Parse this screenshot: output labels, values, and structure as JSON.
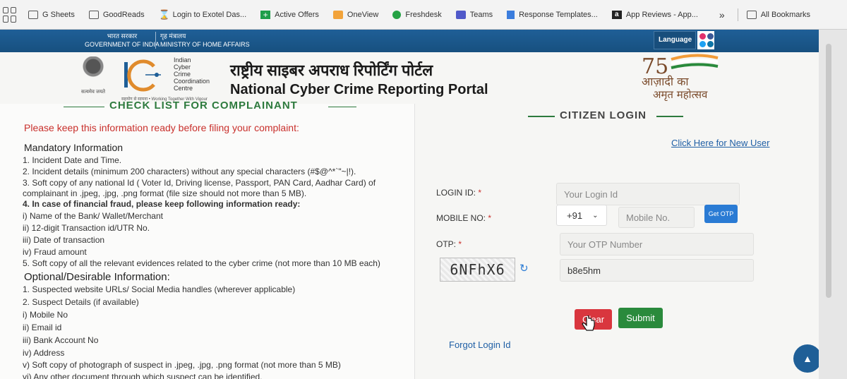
{
  "bookmarks": {
    "items": [
      {
        "label": "G Sheets",
        "icon": "folder-icon"
      },
      {
        "label": "GoodReads",
        "icon": "folder-icon"
      },
      {
        "label": "Login to Exotel Das...",
        "icon": "exotel-icon"
      },
      {
        "label": "Active Offers",
        "icon": "sheets-plus-icon"
      },
      {
        "label": "OneView",
        "icon": "oneview-icon"
      },
      {
        "label": "Freshdesk",
        "icon": "freshdesk-icon"
      },
      {
        "label": "Teams",
        "icon": "teams-icon"
      },
      {
        "label": "Response Templates...",
        "icon": "docs-icon"
      },
      {
        "label": "App Reviews - App...",
        "icon": "app-reviews-icon"
      }
    ],
    "more": "»",
    "all_bookmarks": "All Bookmarks"
  },
  "gov_bar": {
    "hindi_govt": "भारत सरकार",
    "english_govt": "GOVERNMENT OF INDIA",
    "hindi_ministry": "गृह मंत्रालय",
    "english_ministry": "MINISTRY OF HOME AFFAIRS",
    "language": "Language"
  },
  "header": {
    "emblem_motto": "सत्यमेव जयते",
    "i4c_lines": [
      "Indian",
      "Cyber",
      "Crime",
      "Coordination",
      "Centre"
    ],
    "i4c_tagline": "सहयोग से सामना • Working Together With Vigour",
    "portal_hindi": "राष्ट्रीय साइबर अपराध रिपोर्टिंग पोर्टल",
    "portal_english": "National Cyber Crime Reporting Portal",
    "azadi_line1": "आज़ादी का",
    "azadi_line2": "अमृत महोत्सव",
    "azadi_number": "75"
  },
  "checklist": {
    "title": "CHECK LIST FOR COMPLAINANT",
    "warning": "Please keep this information ready before filing your complaint:",
    "mandatory_heading": "Mandatory Information",
    "mandatory": [
      "1. Incident Date and Time.",
      "2. Incident details (minimum 200 characters) without any special characters (#$@^*`\"~|!).",
      "3. Soft copy of any national Id ( Voter Id, Driving license, Passport, PAN Card, Aadhar Card) of",
      "complainant in .jpeg, .jpg, .png format (file size should not more than 5 MB).",
      "4. In case of financial fraud, please keep following information ready:",
      "i) Name of the Bank/ Wallet/Merchant",
      "ii) 12-digit Transaction id/UTR No.",
      "iii) Date of transaction",
      "iv) Fraud amount",
      "5. Soft copy of all the relevant evidences related to the cyber crime (not more than 10 MB each)"
    ],
    "optional_heading": "Optional/Desirable Information:",
    "optional": [
      "1. Suspected website URLs/ Social Media handles (wherever applicable)",
      "2. Suspect Details (if available)",
      "i) Mobile No",
      "ii) Email id",
      "iii) Bank Account No",
      "iv) Address",
      "v) Soft copy of photograph of suspect in .jpeg, .jpg, .png format (not more than 5 MB)",
      "vi) Any other document through which suspect can be identified."
    ]
  },
  "login": {
    "title": "CITIZEN LOGIN",
    "new_user_link": "Click Here for New User",
    "login_id_label": "LOGIN ID:",
    "login_id_placeholder": "Your Login Id",
    "mobile_label": "MOBILE NO:",
    "country_code": "+91",
    "mobile_placeholder": "Mobile No.",
    "get_otp": "Get OTP",
    "otp_label": "OTP:",
    "otp_placeholder": "Your OTP Number",
    "captcha_text": "6NFhX6",
    "captcha_value": "b8e5hm",
    "required_marker": "*",
    "clear_button": "Clear",
    "submit_button": "Submit",
    "forgot_link": "Forgot Login Id"
  },
  "colors": {
    "gov_blue": "#1f5f97",
    "green": "#2a8a3c",
    "red": "#d9363e",
    "link_blue": "#1f5fa5"
  }
}
